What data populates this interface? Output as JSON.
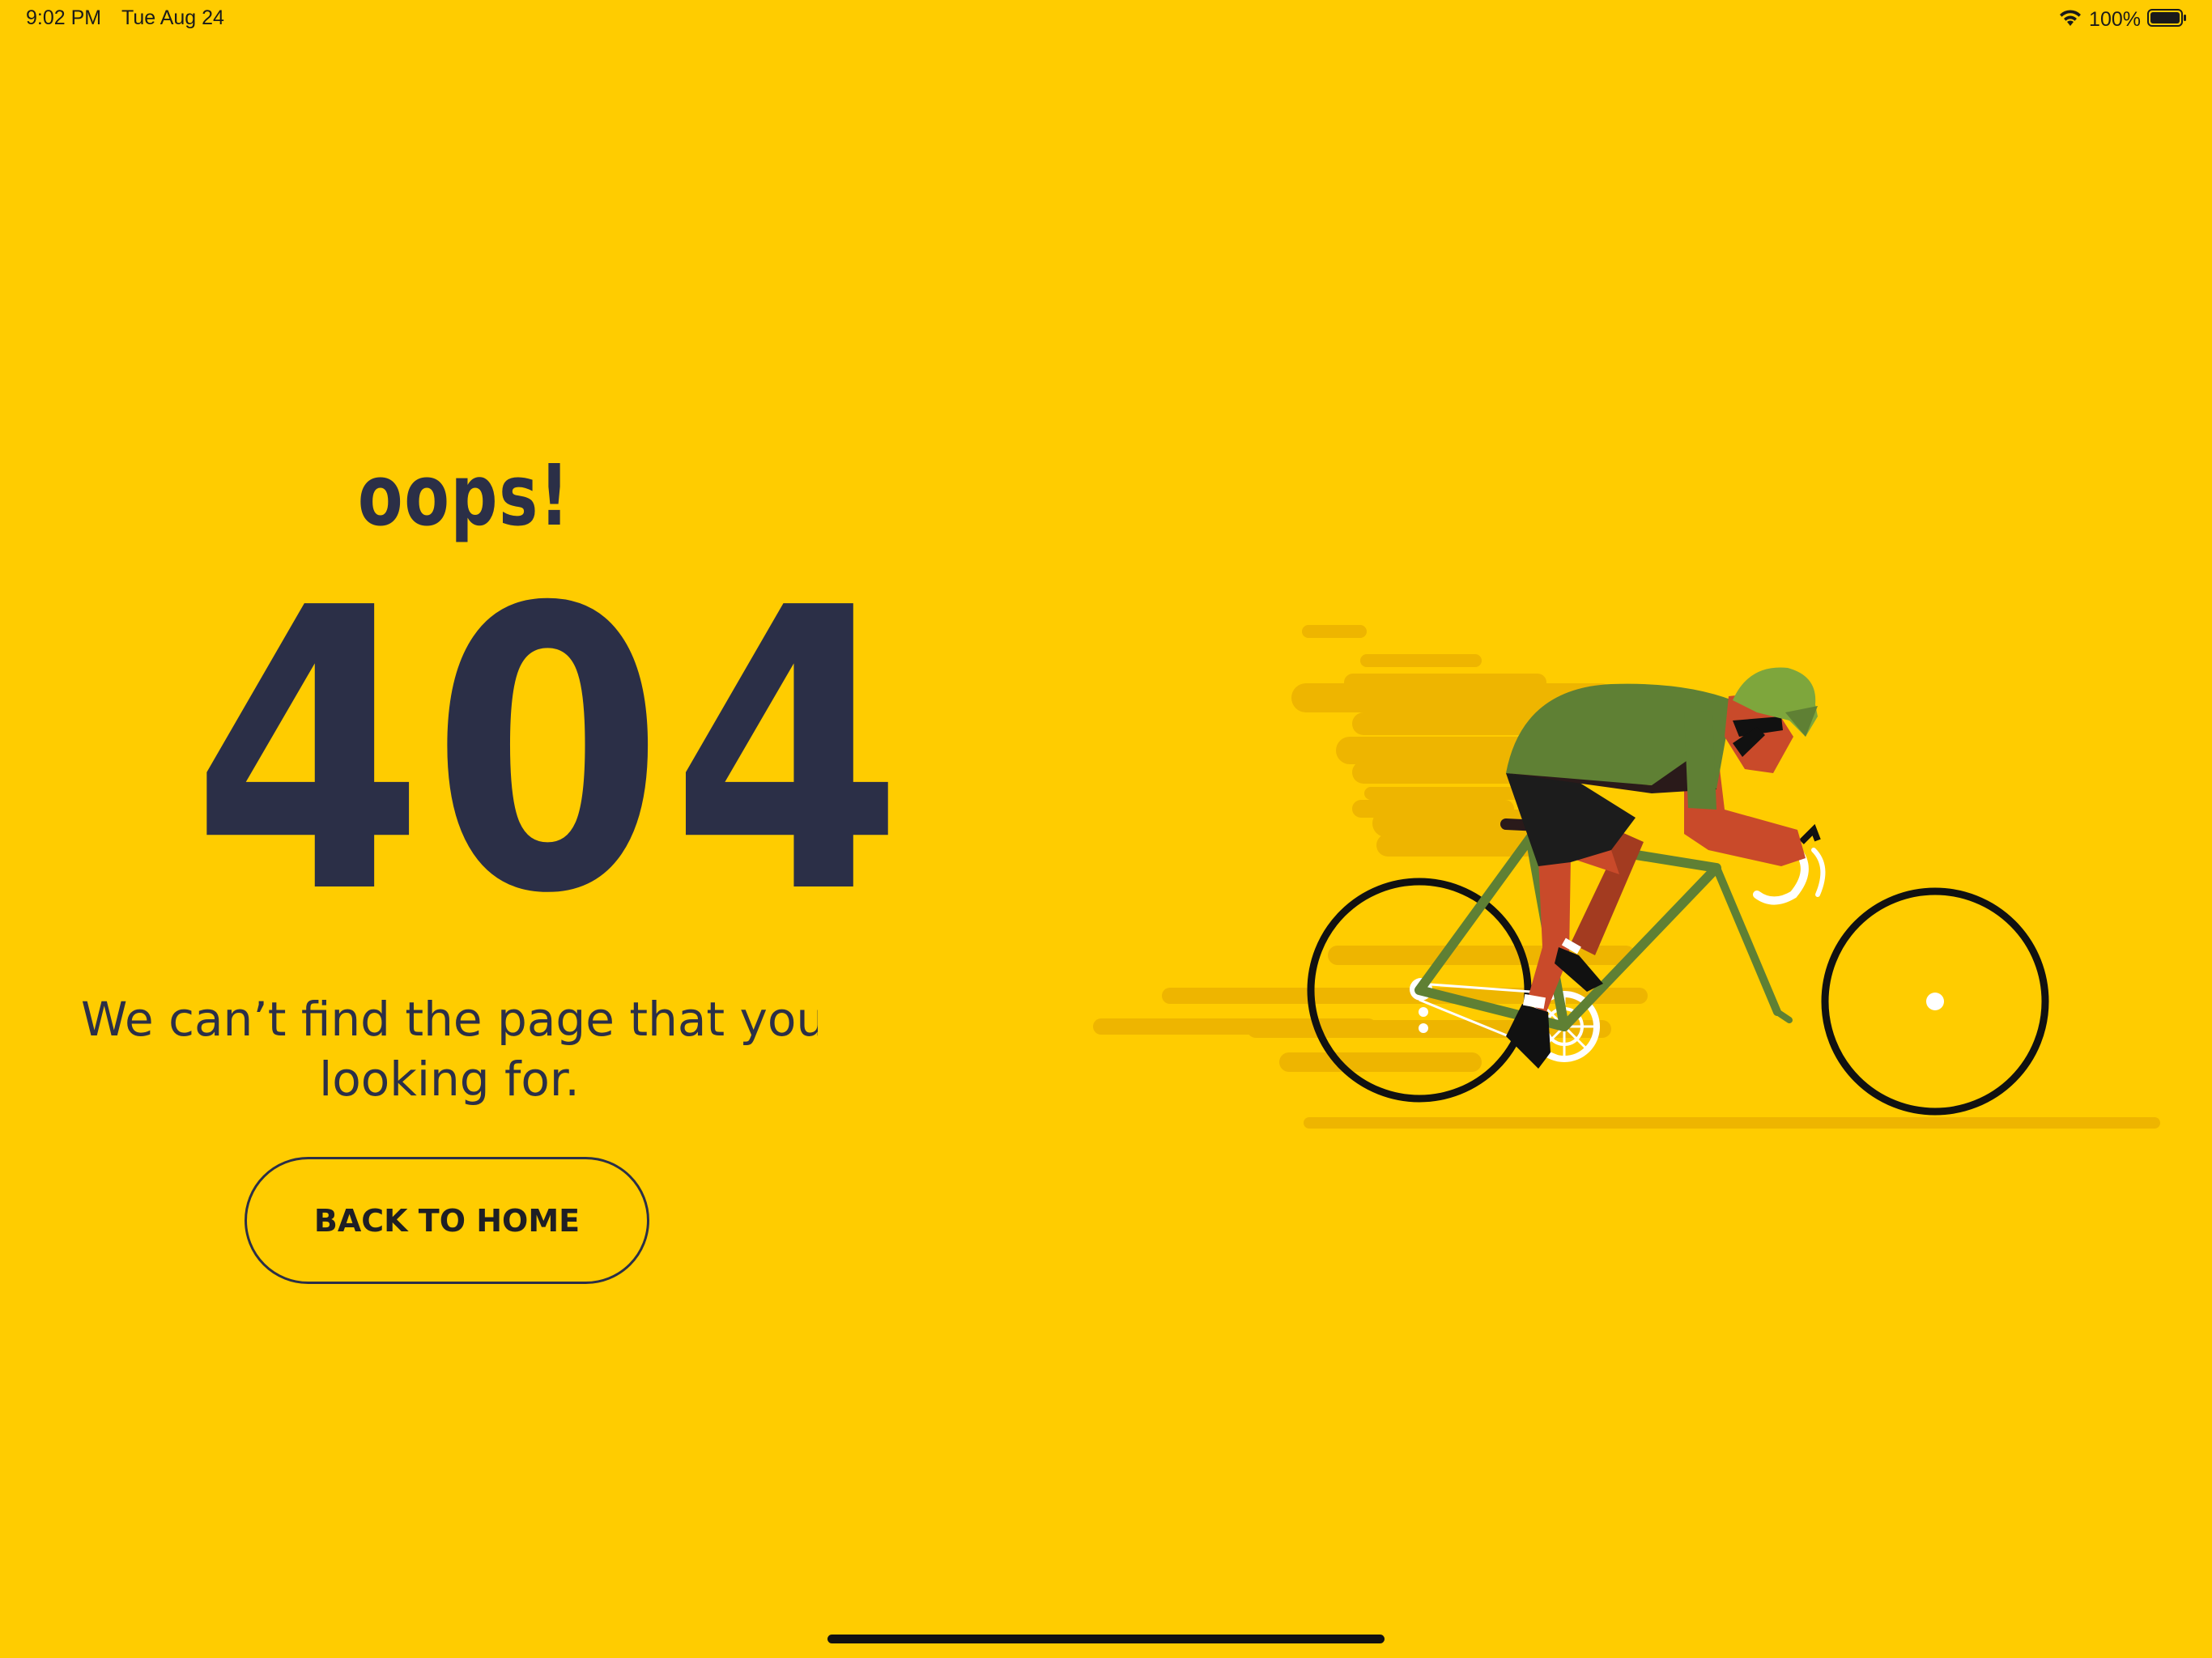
{
  "status_bar": {
    "time": "9:02 PM",
    "date": "Tue Aug 24",
    "battery": "100%",
    "icons": [
      "wifi-icon",
      "battery-icon"
    ]
  },
  "error": {
    "exclaim": "oops!",
    "code": "404",
    "message_line1": "We can’t find the page that you’",
    "message_line2": "looking for.",
    "button_label": "BACK TO HOME"
  },
  "illustration": {
    "name": "cyclist-illustration"
  },
  "colors": {
    "background": "#FFCC00",
    "text": "#2B2F47",
    "speed_lines": "#EEB500",
    "jersey": "#5F8034",
    "skin": "#C94A2A",
    "helmet": "#7EA63C",
    "wheel": "#111111"
  }
}
